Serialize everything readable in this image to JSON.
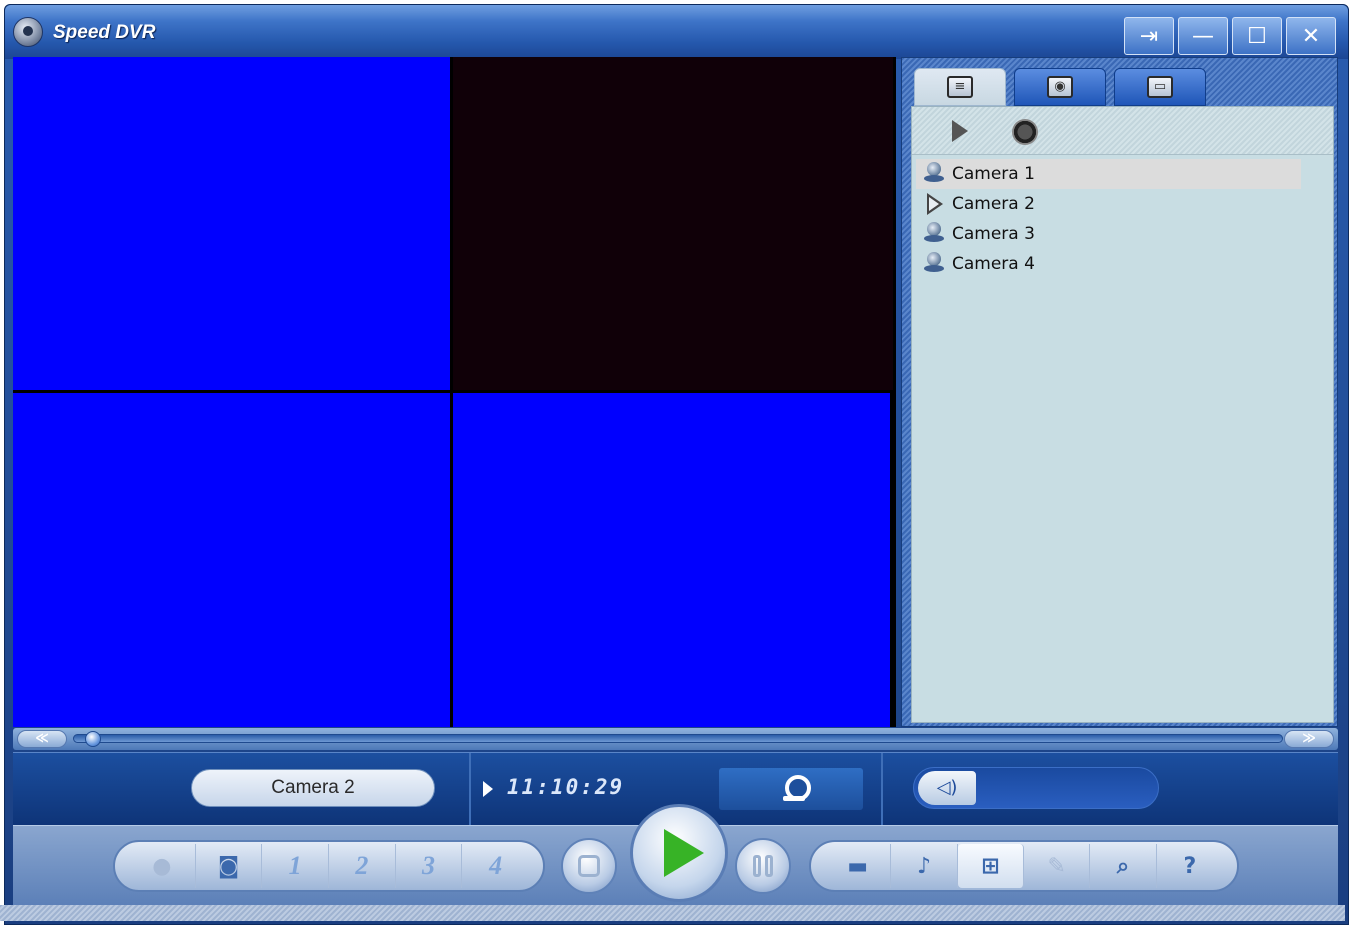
{
  "window": {
    "title": "Speed DVR",
    "buttons": [
      "⇥",
      "—",
      "☐",
      "✕"
    ]
  },
  "panel": {
    "tabs": [
      {
        "icon": "camera-list-icon"
      },
      {
        "icon": "snapshot-icon"
      },
      {
        "icon": "tape-icon"
      }
    ],
    "cameras": [
      {
        "label": "Camera 1",
        "icon": "webcam-icon",
        "selected": true
      },
      {
        "label": "Camera 2",
        "icon": "play-icon",
        "selected": false
      },
      {
        "label": "Camera 3",
        "icon": "webcam-icon",
        "selected": false
      },
      {
        "label": "Camera 4",
        "icon": "webcam-icon",
        "selected": false
      }
    ]
  },
  "seek": {
    "rewind": "≪",
    "forward": "≫"
  },
  "status": {
    "camera_name": "Camera 2",
    "time": "11:10:29",
    "volume_icon": "◁)"
  },
  "controls": {
    "channels": [
      "1",
      "2",
      "3",
      "4"
    ],
    "tools": [
      "open-folder",
      "alarm-bell",
      "grid-layout",
      "settings-wrench",
      "search",
      "help"
    ],
    "help": "?"
  },
  "colors": {
    "video_blue": "#0000ff",
    "video_dark": "#100008",
    "play_green": "#37b326",
    "accent": "#2558ad"
  }
}
